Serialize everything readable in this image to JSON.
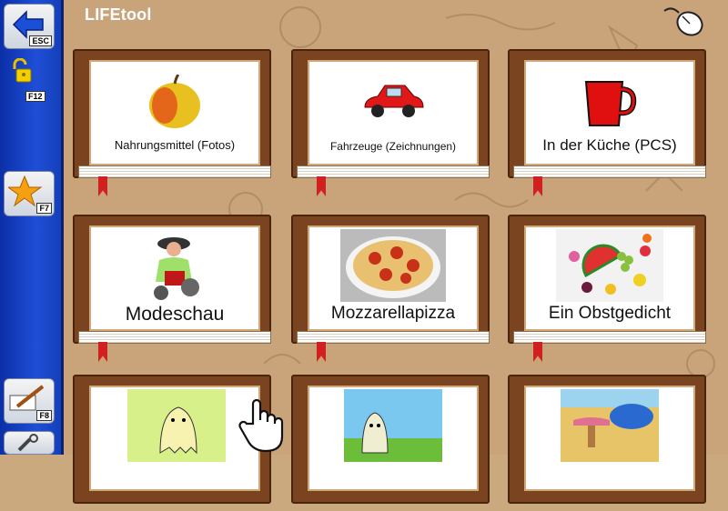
{
  "app": {
    "title": "LIFEtool"
  },
  "sidebar": {
    "buttons": [
      {
        "name": "back",
        "key": "ESC"
      },
      {
        "name": "unlock",
        "key": "F12"
      },
      {
        "name": "favorites",
        "key": "F7"
      },
      {
        "name": "edit",
        "key": "F8"
      }
    ]
  },
  "books": [
    {
      "label": "Nahrungsmittel (Fotos)",
      "picture": "apple"
    },
    {
      "label": "Fahrzeuge (Zeichnungen)",
      "picture": "red-car"
    },
    {
      "label": "In der Küche (PCS)",
      "picture": "red-mug"
    },
    {
      "label": "Modeschau",
      "picture": "fashion-person"
    },
    {
      "label": "Mozzarellapizza",
      "picture": "pizza"
    },
    {
      "label": "Ein Obstgedicht",
      "picture": "fruit-platter"
    },
    {
      "label": "",
      "picture": "ghost-green-bg"
    },
    {
      "label": "",
      "picture": "ghost-blue-sky"
    },
    {
      "label": "",
      "picture": "desert-scene"
    }
  ]
}
